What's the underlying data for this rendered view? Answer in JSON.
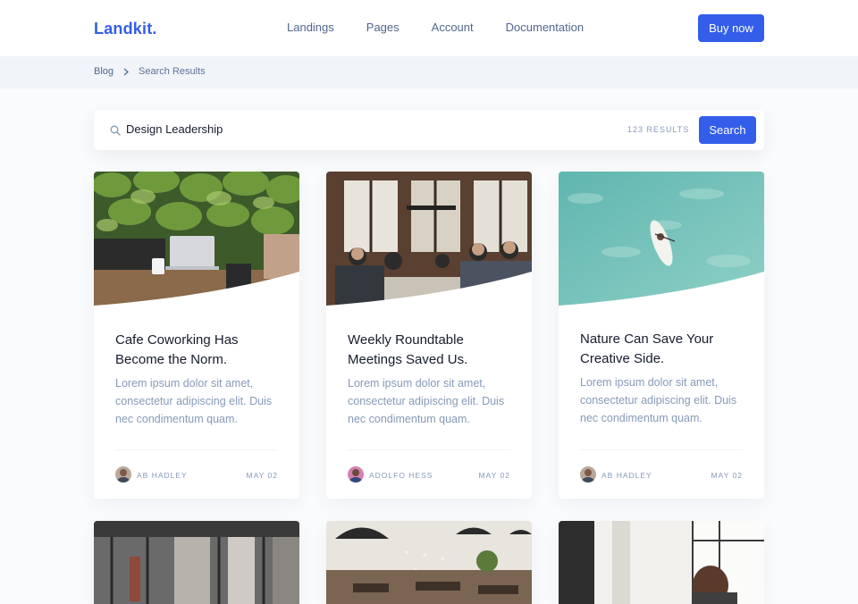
{
  "navbar": {
    "brand": "Landkit.",
    "links": [
      "Landings",
      "Pages",
      "Account",
      "Documentation"
    ],
    "cta_label": "Buy now"
  },
  "breadcrumb": {
    "items": [
      "Blog",
      "Search Results"
    ]
  },
  "search": {
    "value": "Design Leadership",
    "results_label": "123 RESULTS",
    "button_label": "Search"
  },
  "cards": [
    {
      "title": "Cafe Coworking Has Become the Norm.",
      "text": "Lorem ipsum dolor sit amet, consectetur adipiscing elit. Duis nec condimentum quam.",
      "author": "AB HADLEY",
      "date": "MAY 02",
      "image": "cafe-laptop-photo"
    },
    {
      "title": "Weekly Roundtable Meetings Saved Us.",
      "text": "Lorem ipsum dolor sit amet, consectetur adipiscing elit. Duis nec condimentum quam.",
      "author": "ADOLFO HESS",
      "date": "MAY 02",
      "image": "meeting-table-photo"
    },
    {
      "title": "Nature Can Save Your Creative Side.",
      "text": "Lorem ipsum dolor sit amet, consectetur adipiscing elit. Duis nec condimentum quam.",
      "author": "AB HADLEY",
      "date": "MAY 02",
      "image": "paddleboard-water-photo"
    }
  ],
  "colors": {
    "primary": "#335eea",
    "text_muted": "#869ab8",
    "nav_text": "#506690",
    "heading": "#161c2d",
    "breadcrumb_bg": "#f1f4f8"
  },
  "icons": {
    "search": "search-icon",
    "breadcrumb_separator": "chevron-right-icon"
  }
}
